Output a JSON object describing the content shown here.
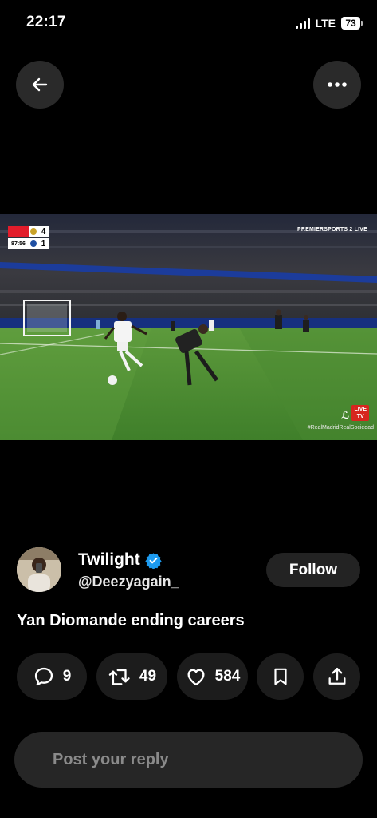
{
  "status_bar": {
    "time": "22:17",
    "network": "LTE",
    "battery": "73"
  },
  "top_bar": {
    "back_icon": "arrow-left-icon",
    "more_icon": "more-horizontal-icon"
  },
  "media": {
    "scoreboard": {
      "home_score": "4",
      "away_score": "1",
      "clock": "87:56"
    },
    "broadcaster": "PREMIERSPORTS 2 LIVE",
    "live_badge": "LIVE",
    "live_badge_brand": "TV",
    "hashtag": "#RealMadridRealSociedad"
  },
  "post": {
    "author_name": "Twilight",
    "author_handle": "@Deezyagain_",
    "verified": true,
    "follow_label": "Follow",
    "text": "Yan Diomande ending careers"
  },
  "actions": {
    "replies": "9",
    "reposts": "49",
    "likes": "584",
    "icons": [
      "reply-icon",
      "repost-icon",
      "like-icon",
      "bookmark-icon",
      "share-icon"
    ]
  },
  "reply": {
    "placeholder": "Post your reply"
  },
  "colors": {
    "background": "#000000",
    "pill": "#1c1c1c",
    "verified_blue": "#1d9bf0",
    "reply_box": "#262626",
    "placeholder": "#8a8a8a"
  }
}
